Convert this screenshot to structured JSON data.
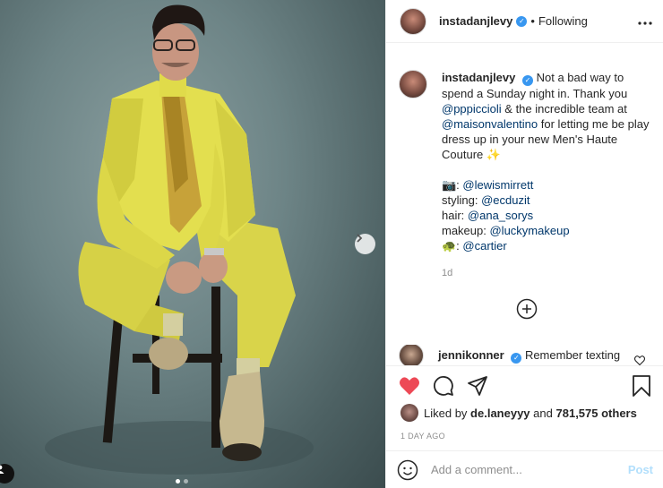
{
  "post": {
    "username": "instadanjlevy",
    "follow_status": "Following",
    "more_icon": "ellipsis-icon",
    "caption": {
      "lines": [
        [
          {
            "t": "text",
            "v": "Not a bad way to spend a Sunday night in. Thank you "
          }
        ],
        [
          {
            "t": "link",
            "v": "@pppiccioli"
          },
          {
            "t": "text",
            "v": " & the incredible team at "
          },
          {
            "t": "link",
            "v": "@maisonvalentino"
          },
          {
            "t": "text",
            "v": " for letting me be play dress up in your new Men's Haute Couture ✨"
          }
        ]
      ],
      "credits": [
        {
          "label": "📷: ",
          "handle": "@lewismirrett"
        },
        {
          "label": "styling: ",
          "handle": "@ecduzit"
        },
        {
          "label": "hair: ",
          "handle": "@ana_sorys"
        },
        {
          "label": "makeup: ",
          "handle": "@luckymakeup"
        },
        {
          "label": "🐢: ",
          "handle": "@cartier"
        }
      ],
      "time_ago": "1d"
    },
    "comment": {
      "username": "jennikonner",
      "text": "Remember texting"
    },
    "likes": {
      "prefix": "Liked by ",
      "user": "de.laneyyy",
      "middle": " and ",
      "count": "781,575 others"
    },
    "date": "1 DAY AGO",
    "add_comment_placeholder": "Add a comment...",
    "post_label": "Post"
  },
  "carousel": {
    "slide_count": 2,
    "active_slide": 1
  },
  "colors": {
    "like_red": "#ed4956",
    "link_blue": "#00376b",
    "verified_blue": "#3897f0",
    "post_disabled": "#b2dffc",
    "suit_yellow": "#e3df4f"
  }
}
